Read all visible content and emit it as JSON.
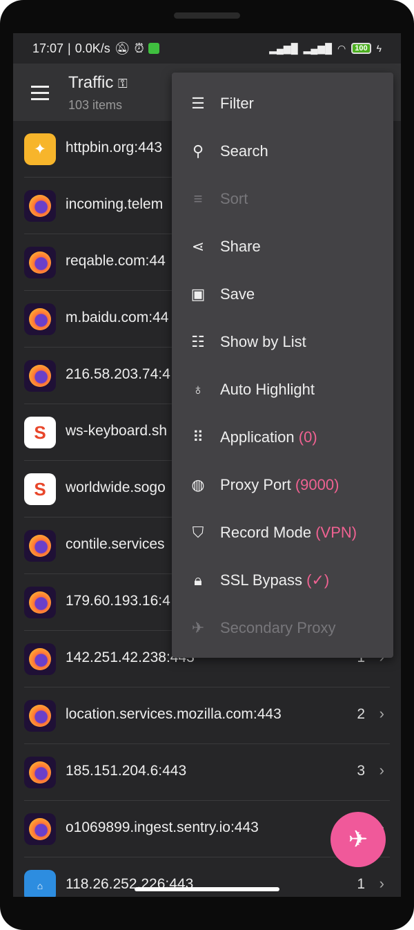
{
  "status": {
    "time": "17:07",
    "speed": "0.0K/s",
    "battery": "100"
  },
  "header": {
    "title": "Traffic",
    "subtitle": "103 items"
  },
  "rows": [
    {
      "host": "httpbin.org:443",
      "icon": "hb",
      "count": ""
    },
    {
      "host": "incoming.telem",
      "icon": "ff",
      "count": ""
    },
    {
      "host": "reqable.com:44",
      "icon": "ff",
      "count": ""
    },
    {
      "host": "m.baidu.com:44",
      "icon": "ff",
      "count": ""
    },
    {
      "host": "216.58.203.74:4",
      "icon": "ff",
      "count": ""
    },
    {
      "host": "ws-keyboard.sh",
      "icon": "sg",
      "count": ""
    },
    {
      "host": "worldwide.sogo",
      "icon": "sg",
      "count": ""
    },
    {
      "host": "contile.services",
      "icon": "ff",
      "count": ""
    },
    {
      "host": "179.60.193.16:4",
      "icon": "ff",
      "count": ""
    },
    {
      "host": "142.251.42.238:443",
      "icon": "ff",
      "count": "1"
    },
    {
      "host": "location.services.mozilla.com:443",
      "icon": "ff",
      "count": "2"
    },
    {
      "host": "185.151.204.6:443",
      "icon": "ff",
      "count": "3"
    },
    {
      "host": "o1069899.ingest.sentry.io:443",
      "icon": "ff",
      "count": ""
    },
    {
      "host": "118.26.252.226:443",
      "icon": "mi",
      "count": "1"
    }
  ],
  "menu": [
    {
      "label": "Filter",
      "icon": "☰",
      "extra": "",
      "disabled": false
    },
    {
      "label": "Search",
      "icon": "⚲",
      "extra": "",
      "disabled": false
    },
    {
      "label": "Sort",
      "icon": "≡",
      "extra": "",
      "disabled": true
    },
    {
      "label": "Share",
      "icon": "⋖",
      "extra": "",
      "disabled": false
    },
    {
      "label": "Save",
      "icon": "▣",
      "extra": "",
      "disabled": false
    },
    {
      "label": "Show by List",
      "icon": "☷",
      "extra": "",
      "disabled": false
    },
    {
      "label": "Auto Highlight",
      "icon": "♁",
      "extra": "",
      "disabled": false
    },
    {
      "label": "Application",
      "icon": "⠿",
      "extra": "(0)",
      "disabled": false
    },
    {
      "label": "Proxy Port",
      "icon": "◍",
      "extra": "(9000)",
      "disabled": false
    },
    {
      "label": "Record Mode",
      "icon": "⛉",
      "extra": "(VPN)",
      "disabled": false
    },
    {
      "label": "SSL Bypass",
      "icon": "🔒︎",
      "extra": "(✓)",
      "disabled": false
    },
    {
      "label": "Secondary Proxy",
      "icon": "✈",
      "extra": "",
      "disabled": true
    }
  ],
  "accent": "#f06292"
}
